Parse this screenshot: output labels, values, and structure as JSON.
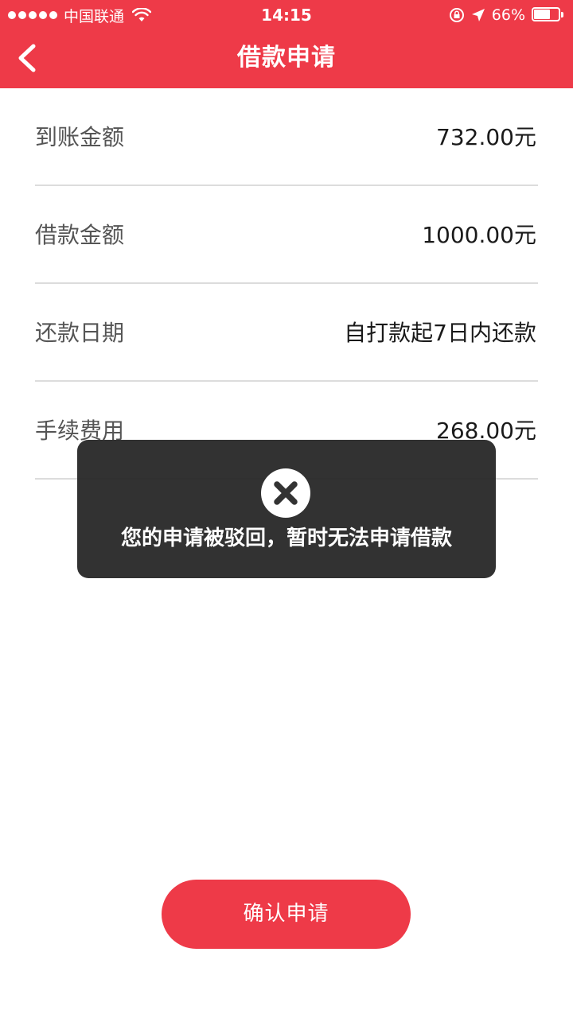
{
  "status_bar": {
    "carrier": "中国联通",
    "time": "14:15",
    "battery_percent_label": "66%",
    "battery_level": 0.66,
    "icons": [
      "signal-dots",
      "wifi-icon",
      "rotation-lock-icon",
      "location-arrow-icon",
      "battery-icon"
    ]
  },
  "header": {
    "title": "借款申请",
    "back_icon": "chevron-left-icon",
    "background_color": "#ee3a48"
  },
  "info_rows": [
    {
      "label": "到账金额",
      "value": "732.00元"
    },
    {
      "label": "借款金额",
      "value": "1000.00元"
    },
    {
      "label": "还款日期",
      "value": "自打款起7日内还款"
    },
    {
      "label": "手续费用",
      "value": "268.00元"
    }
  ],
  "toast": {
    "icon": "close-circle-icon",
    "message": "您的申请被驳回，暂时无法申请借款"
  },
  "confirm_button": {
    "label": "确认申请",
    "color": "#ee3a48"
  }
}
